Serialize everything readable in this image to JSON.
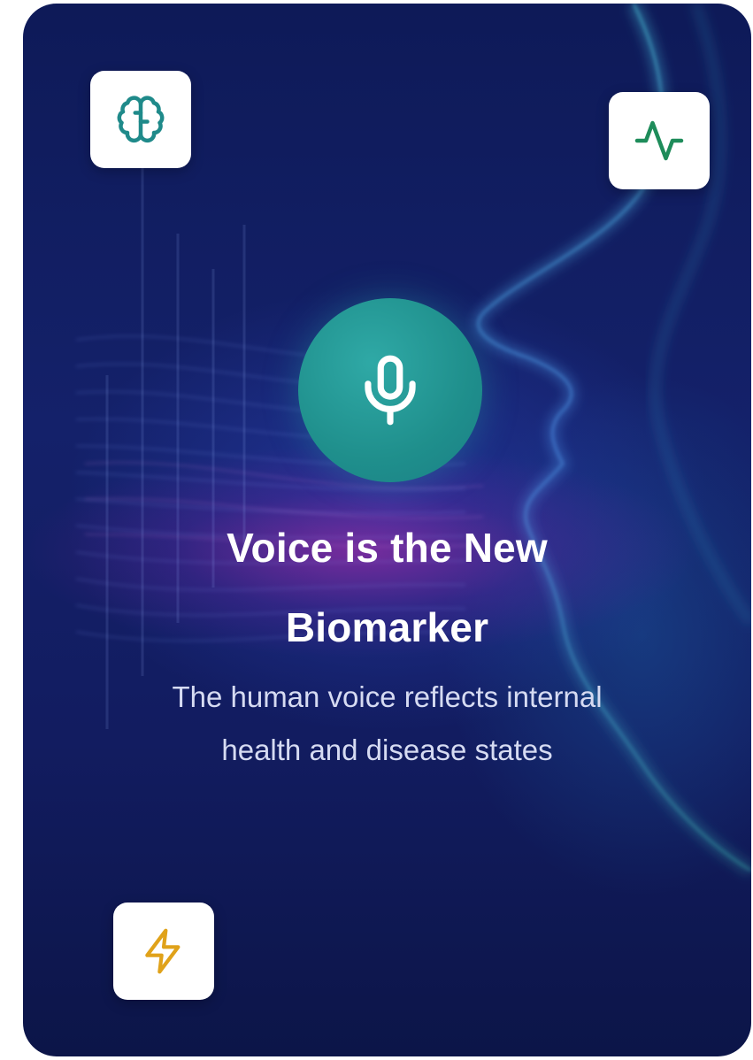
{
  "card": {
    "title_line1": "Voice is the New",
    "title_line2": "Biomarker",
    "subtitle_line1": "The human voice reflects internal",
    "subtitle_line2": "health and disease states"
  },
  "icons": {
    "top_left": "brain-icon",
    "top_right": "activity-icon",
    "bottom_left": "zap-icon",
    "center": "microphone-icon"
  },
  "colors": {
    "background": "#14216a",
    "accent_teal": "#1f8f8c",
    "brain_icon": "#1f8a8a",
    "activity_icon": "#1e8c5a",
    "zap_icon": "#e0a21a"
  }
}
